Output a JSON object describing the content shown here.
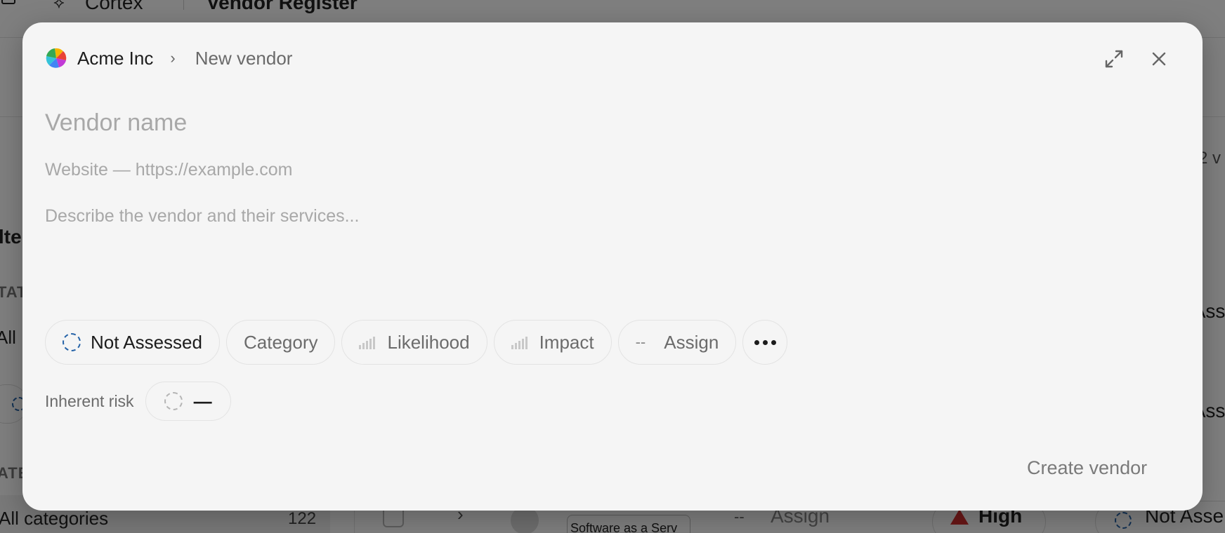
{
  "background": {
    "topbar": {
      "app_name": "Cortex",
      "page_title": "Vendor Register"
    },
    "vendor_count_partial": "2 v",
    "sidebar": {
      "filters_partial": "lte",
      "status_label_partial": "TAT",
      "status_all_partial": "All",
      "category_label_partial": "ATE",
      "category_all": "All categories",
      "category_count": "122"
    },
    "right_partial_1": "Asse",
    "right_partial_2": "Asse",
    "row": {
      "chevron": "›",
      "category": "Software as a Serv",
      "assign_dash": "--",
      "assign": "Assign",
      "risk": "High",
      "status": "Not Asse"
    }
  },
  "modal": {
    "org_name": "Acme Inc",
    "breadcrumb_sep": "›",
    "page_title": "New vendor",
    "fields": {
      "name_placeholder": "Vendor name",
      "website_placeholder": "Website — https://example.com",
      "description_placeholder": "Describe the vendor and their services..."
    },
    "chips": {
      "status": "Not Assessed",
      "category": "Category",
      "likelihood": "Likelihood",
      "impact": "Impact",
      "assign_dash": "--",
      "assign": "Assign"
    },
    "inherent_risk": {
      "label": "Inherent risk",
      "value": "—"
    },
    "create_button": "Create vendor"
  },
  "colors": {
    "status_ring": "#2563a8",
    "modal_bg": "#f5f5f5",
    "high_risk": "#d32f2f"
  }
}
